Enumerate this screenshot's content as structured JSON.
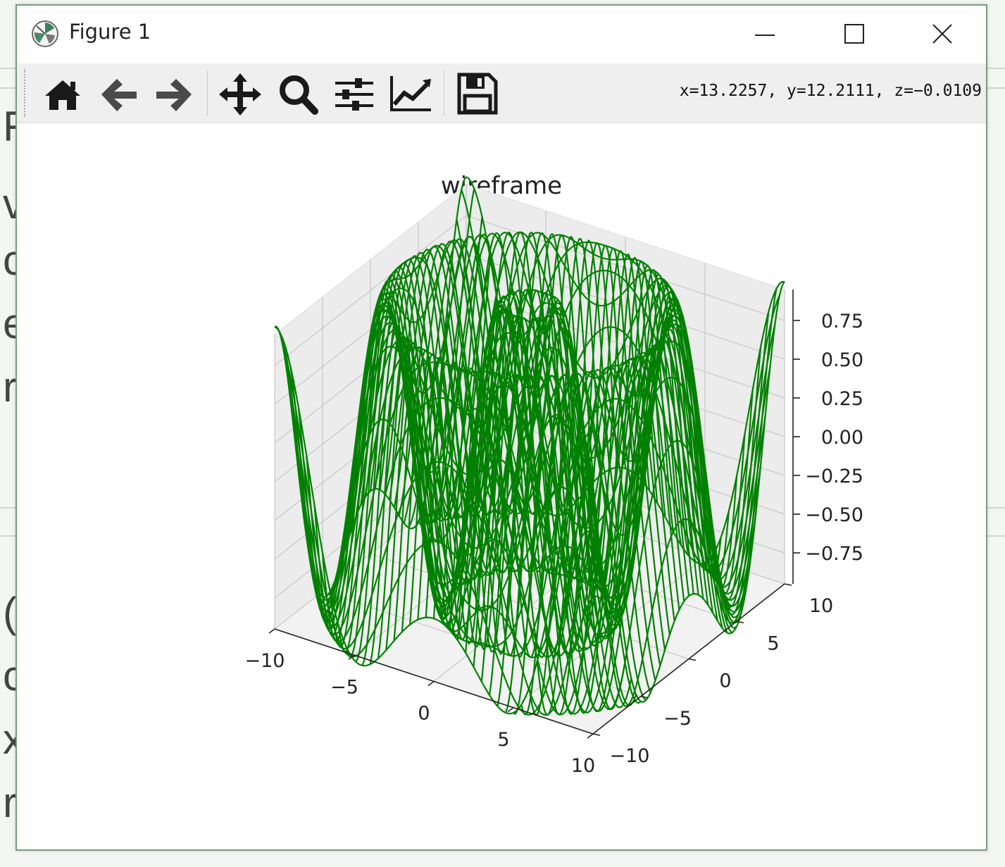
{
  "window": {
    "title": "Figure 1",
    "controls": [
      "minimize",
      "maximize",
      "close"
    ]
  },
  "toolbar": {
    "buttons": [
      {
        "name": "home",
        "icon": "home-icon"
      },
      {
        "name": "back",
        "icon": "arrow-left-icon"
      },
      {
        "name": "forward",
        "icon": "arrow-right-icon"
      },
      {
        "name": "pan",
        "icon": "move-icon"
      },
      {
        "name": "zoom",
        "icon": "magnifier-icon"
      },
      {
        "name": "configure-subplots",
        "icon": "sliders-icon"
      },
      {
        "name": "edit-axes",
        "icon": "line-chart-icon"
      },
      {
        "name": "save",
        "icon": "floppy-disk-icon"
      }
    ],
    "coordinates": "x=13.2257, y=12.2111, z=−0.0109"
  },
  "chart_data": {
    "type": "wireframe",
    "title": "wireframe",
    "color": "#008000",
    "function": "sin(sqrt(x^2 + y^2))",
    "xlim": [
      -10,
      10
    ],
    "ylim": [
      -10,
      10
    ],
    "zlim": [
      -0.95,
      0.95
    ],
    "x_ticks": [
      "−10",
      "−5",
      "0",
      "5",
      "10"
    ],
    "y_ticks": [
      "−10",
      "−5",
      "0",
      "5",
      "10"
    ],
    "z_ticks": [
      "0.75",
      "0.50",
      "0.25",
      "0.00",
      "−0.25",
      "−0.50",
      "−0.75"
    ],
    "grid": true
  }
}
